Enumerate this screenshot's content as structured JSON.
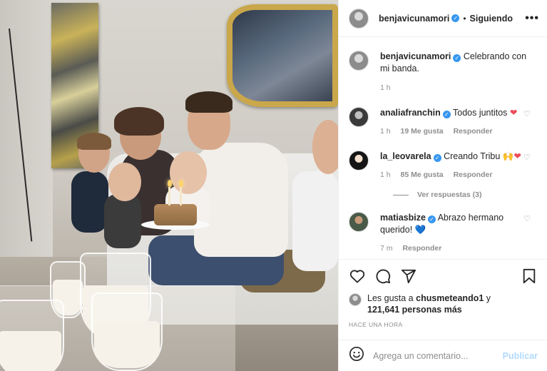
{
  "post": {
    "username": "benjavicunamori",
    "follow_sep": "•",
    "follow_status": "Siguiendo",
    "more": "•••"
  },
  "caption": {
    "username": "benjavicunamori",
    "text": "Celebrando con mi banda.",
    "time": "1 h"
  },
  "comments": [
    {
      "username": "analiafranchin",
      "text": "Todos juntitos",
      "emoji": "❤",
      "time": "1 h",
      "likes": "19 Me gusta",
      "reply": "Responder"
    },
    {
      "username": "la_leovarela",
      "text": "Creando Tribu",
      "emoji": "🙌❤",
      "time": "1 h",
      "likes": "85 Me gusta",
      "reply": "Responder",
      "view_replies": "Ver respuestas (3)"
    },
    {
      "username": "matiasbize",
      "text": "Abrazo hermano querido!",
      "emoji": "💙",
      "time": "7 m",
      "reply": "Responder"
    }
  ],
  "likes": {
    "prefix": "Les gusta a",
    "user": "chusmeteando1",
    "suffix": "y",
    "count": "121,641 personas más"
  },
  "timestamp": "Hace una hora",
  "composer": {
    "placeholder": "Agrega un comentario...",
    "publish": "Publicar"
  },
  "icons": {
    "heart": "heart-icon",
    "comment": "comment-icon",
    "share": "paper-plane-icon",
    "save": "bookmark-icon",
    "emoji": "smiley-icon",
    "verified": "verified-badge-icon"
  },
  "colors": {
    "verified": "#3897f0",
    "like_heart": "#ed4956",
    "publish_disabled": "#b3dbff",
    "muted": "#8e8e8e"
  }
}
